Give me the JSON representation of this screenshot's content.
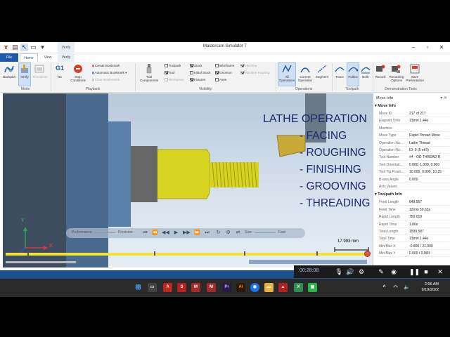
{
  "window": {
    "title": "Mastercam Simulator T",
    "context_tab": "Verify"
  },
  "tabs": [
    "File",
    "Home",
    "View",
    "Verify"
  ],
  "ribbon": {
    "mode": {
      "label": "Mode",
      "backplot": "Backplot",
      "verify": "Verify",
      "simulation": "Simulation"
    },
    "playback": {
      "label": "Playback",
      "nc": "NC",
      "nc_badge": "G1",
      "stop_conditions": "Stop Conditions",
      "create_bookmark": "Create Bookmark",
      "automatic_bookmark": "Automatic Bookmark",
      "clear_bookmarks": "Clear Bookmarks"
    },
    "visibility": {
      "label": "Visibility",
      "tool_components": "Tool Components",
      "checks": [
        {
          "name": "Toolpath",
          "on": false,
          "enabled": true
        },
        {
          "name": "Stock",
          "on": true,
          "enabled": true
        },
        {
          "name": "Wireframe",
          "on": false,
          "enabled": true
        },
        {
          "name": "Machine",
          "on": true,
          "enabled": false
        },
        {
          "name": "Tool",
          "on": true,
          "enabled": true
        },
        {
          "name": "Initial Stock",
          "on": false,
          "enabled": true
        },
        {
          "name": "Gnomon",
          "on": true,
          "enabled": true
        },
        {
          "name": "Machine Housing",
          "on": true,
          "enabled": false
        },
        {
          "name": "Workpiece",
          "on": false,
          "enabled": false
        },
        {
          "name": "Fixtures",
          "on": true,
          "enabled": true
        },
        {
          "name": "Axes",
          "on": false,
          "enabled": true
        }
      ]
    },
    "operations": {
      "label": "Operations",
      "all": "All Operations",
      "current": "Current Operation",
      "segment": "Segment"
    },
    "toolpath": {
      "label": "Toolpath",
      "trace": "Trace",
      "follow": "Follow",
      "both": "Both"
    },
    "demo": {
      "label": "Demonstration Tools",
      "record": "Record",
      "recording_options": "Recording Options",
      "save": "Save Presentation"
    }
  },
  "viewport": {
    "heading": "LATHE OPERATION",
    "operations": [
      "- FACING",
      "- ROUGHING",
      "- FINISHING",
      "- GROOVING",
      "- THREADING"
    ],
    "scale": "17.993 mm",
    "axes": {
      "x": "X",
      "y": "Y"
    },
    "playback_labels": {
      "performance": "Performance",
      "precision": "Precision",
      "size": "Size",
      "fast": "Fast"
    }
  },
  "progress": {
    "fraction": 1.0
  },
  "move_info": {
    "title": "Move Info",
    "section1": "Move Info",
    "rows1": [
      {
        "k": "Move ID",
        "v": "217 of 217"
      },
      {
        "k": "Elapsed Time",
        "v": "13min 1.44s"
      },
      {
        "k": "Machine",
        "v": ""
      },
      {
        "k": "Move Type",
        "v": "Rapid Thread Move"
      },
      {
        "k": "Operation Na...",
        "v": "Lathe Thread"
      },
      {
        "k": "Operation Nu...",
        "v": "ID: 0 (5 of 5)"
      },
      {
        "k": "Tool Number",
        "v": "#4 - OD THREAD R"
      },
      {
        "k": "Tool Orientati...",
        "v": "0.000, 1.000, 0.000"
      },
      {
        "k": "Tool Tip Positi...",
        "v": "10.000, 0.000, 10.25"
      },
      {
        "k": "B-axis Angle",
        "v": "0.000"
      },
      {
        "k": "Axis Values",
        "v": ""
      }
    ],
    "section2": "Toolpath Info",
    "rows2": [
      {
        "k": "Feed Length",
        "v": "849.567"
      },
      {
        "k": "Feed Time",
        "v": "12min 59.63s"
      },
      {
        "k": "Rapid Length",
        "v": "750.019"
      },
      {
        "k": "Rapid Time",
        "v": "1.80s"
      },
      {
        "k": "Total Length",
        "v": "1599.587"
      },
      {
        "k": "Total Time",
        "v": "13min 1.44s"
      },
      {
        "k": "Min/Max X",
        "v": "-0.800 / 21.000"
      },
      {
        "k": "Min/Max Y",
        "v": "0.000 / 0.000"
      }
    ]
  },
  "recorder": {
    "time": "00:28:08"
  },
  "taskbar": {
    "time": "2:56 AM",
    "date": "9/19/2022"
  },
  "colors": {
    "accent": "#1e5aa8",
    "tool_yellow": "#d7d421",
    "text_navy": "#1a2a6c",
    "progress": "#f2e332"
  }
}
